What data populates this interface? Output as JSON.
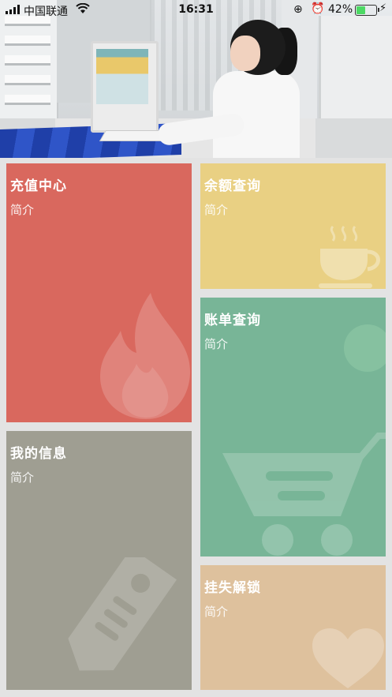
{
  "status_bar": {
    "carrier": "中国联通",
    "time": "16:31",
    "battery_percent": "42%",
    "battery_level": 0.42
  },
  "hero": {
    "image_description_icon": "lab-photo"
  },
  "tiles": [
    {
      "id": "recharge",
      "title": "充值中心",
      "subtitle": "简介",
      "color": "#d9685e",
      "icon": "flame-icon"
    },
    {
      "id": "balance",
      "title": "余额查询",
      "subtitle": "简介",
      "color": "#e9d083",
      "icon": "coffee-cup-icon"
    },
    {
      "id": "bill",
      "title": "账单查询",
      "subtitle": "简介",
      "color": "#78b597",
      "icon": "shopping-cart-icon"
    },
    {
      "id": "myinfo",
      "title": "我的信息",
      "subtitle": "简介",
      "color": "#9f9e92",
      "icon": "tag-icon"
    },
    {
      "id": "unlock",
      "title": "挂失解锁",
      "subtitle": "简介",
      "color": "#dec19d",
      "icon": "heart-icon"
    }
  ]
}
